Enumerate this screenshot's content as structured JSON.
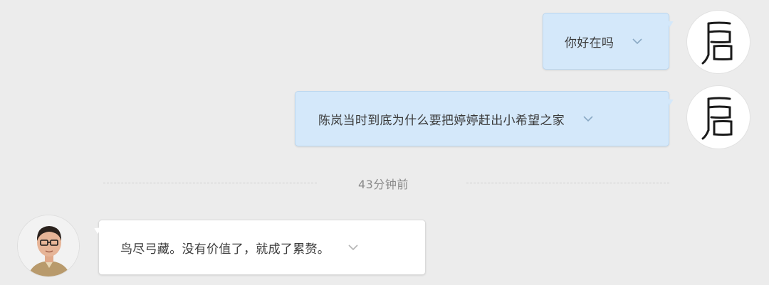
{
  "conversation": {
    "messages": [
      {
        "direction": "outgoing",
        "text": "你好在吗"
      },
      {
        "direction": "outgoing",
        "text": "陈岚当时到底为什么要把婷婷赶出小希望之家"
      },
      {
        "direction": "incoming",
        "text": "鸟尽弓藏。没有价值了，就成了累赘。"
      }
    ],
    "timestamp_divider": "43分钟前",
    "avatars": {
      "me": {
        "icon": "calligraphy-seal-avatar"
      },
      "them": {
        "icon": "man-with-glasses-avatar"
      }
    }
  },
  "colors": {
    "background": "#ececec",
    "outgoing_bubble": "#d4e8fa",
    "incoming_bubble": "#ffffff",
    "timestamp_text": "#8a8a8a"
  }
}
